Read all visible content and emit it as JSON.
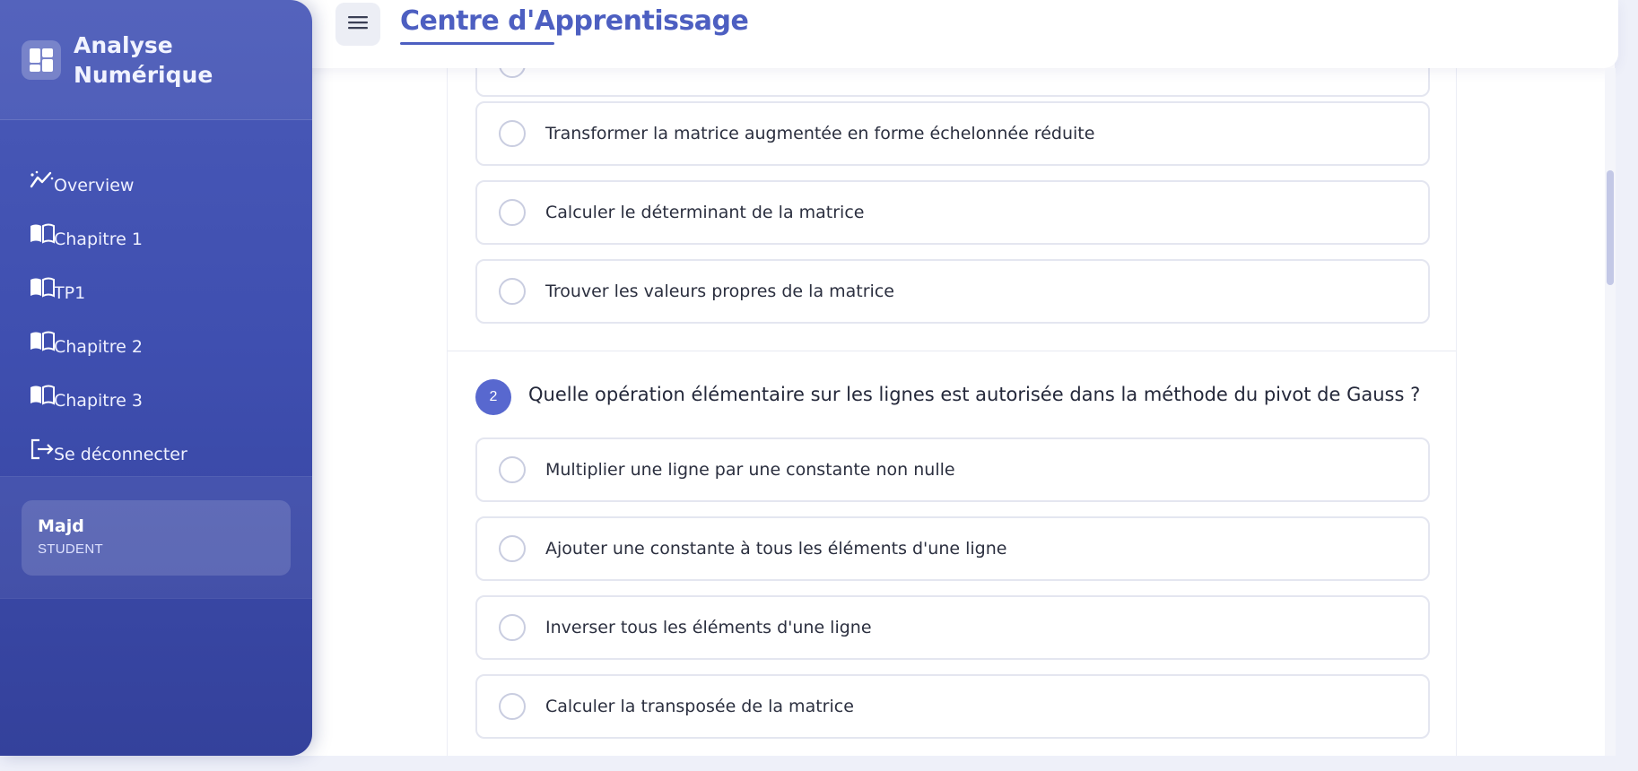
{
  "sidebar": {
    "brand": "Analyse Numérique",
    "nav": [
      {
        "label": "Overview",
        "icon": "trend-chart-icon"
      },
      {
        "label": "Chapitre 1",
        "icon": "book-icon"
      },
      {
        "label": "TP1",
        "icon": "book-icon"
      },
      {
        "label": "Chapitre 2",
        "icon": "book-icon"
      },
      {
        "label": "Chapitre 3",
        "icon": "book-icon"
      },
      {
        "label": "Se déconnecter",
        "icon": "logout-icon"
      }
    ],
    "user": {
      "name": "Majd",
      "role": "STUDENT"
    }
  },
  "header": {
    "title": "Centre d'Apprentissage",
    "menu_icon": "hamburger-menu-icon"
  },
  "quiz": {
    "q1_options": [
      "Transformer la matrice augmentée en forme échelonnée réduite",
      "Calculer le déterminant de la matrice",
      "Trouver les valeurs propres de la matrice"
    ],
    "q2": {
      "number": "2",
      "text": "Quelle opération élémentaire sur les lignes est autorisée dans la méthode du pivot de Gauss ?",
      "options": [
        "Multiplier une ligne par une constante non nulle",
        "Ajouter une constante à tous les éléments d'une ligne",
        "Inverser tous les éléments d'une ligne",
        "Calculer la transposée de la matrice"
      ]
    }
  },
  "colors": {
    "sidebar_top": "#4a5ab8",
    "sidebar_bottom": "#34419b",
    "accent": "#4d5fc1",
    "question_badge": "#5868cf"
  }
}
